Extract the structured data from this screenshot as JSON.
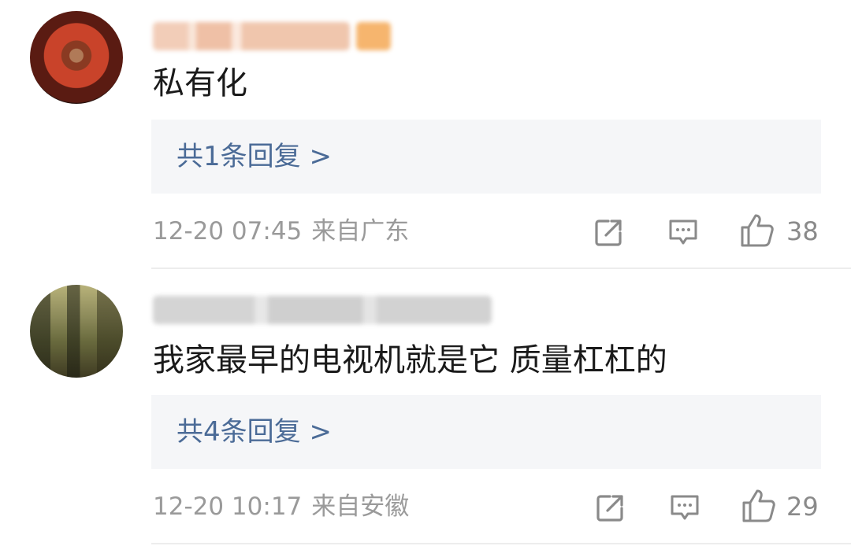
{
  "comments": [
    {
      "text": "私有化",
      "reply_link": "共1条回复 >",
      "timestamp": "12-20 07:45",
      "location": "来自广东",
      "likes": "38"
    },
    {
      "text": "我家最早的电视机就是它 质量杠杠的",
      "reply_link": "共4条回复 >",
      "timestamp": "12-20 10:17",
      "location": "来自安徽",
      "likes": "29"
    }
  ],
  "icons": {
    "share": "share-icon",
    "comment": "comment-icon",
    "like": "thumbs-up-icon"
  }
}
